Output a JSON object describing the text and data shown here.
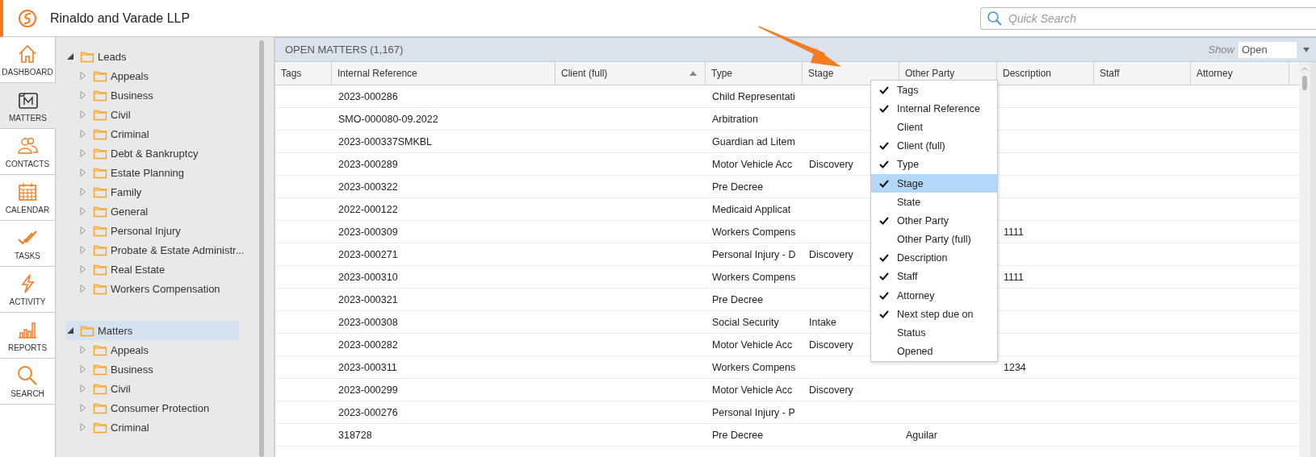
{
  "header": {
    "title": "Rinaldo and Varade LLP",
    "search": {
      "placeholder": "Quick Search"
    }
  },
  "nav": [
    {
      "label": "DASHBOARD",
      "kind": "home",
      "selected": false
    },
    {
      "label": "MATTERS",
      "kind": "matters",
      "selected": true
    },
    {
      "label": "CONTACTS",
      "kind": "contacts",
      "selected": false
    },
    {
      "label": "CALENDAR",
      "kind": "calendar",
      "selected": false
    },
    {
      "label": "TASKS",
      "kind": "tasks",
      "selected": false
    },
    {
      "label": "ACTIVITY",
      "kind": "activity",
      "selected": false
    },
    {
      "label": "REPORTS",
      "kind": "reports",
      "selected": false
    },
    {
      "label": "SEARCH",
      "kind": "search",
      "selected": false
    }
  ],
  "tree": [
    {
      "label": "Leads",
      "expanded": true,
      "selected": false,
      "children": [
        {
          "label": "Appeals",
          "expanded": false,
          "selected": false
        },
        {
          "label": "Business",
          "expanded": false,
          "selected": false
        },
        {
          "label": "Civil",
          "expanded": false,
          "selected": false
        },
        {
          "label": "Criminal",
          "expanded": false,
          "selected": false
        },
        {
          "label": "Debt & Bankruptcy",
          "expanded": false,
          "selected": false
        },
        {
          "label": "Estate Planning",
          "expanded": false,
          "selected": false
        },
        {
          "label": "Family",
          "expanded": false,
          "selected": false
        },
        {
          "label": "General",
          "expanded": false,
          "selected": false
        },
        {
          "label": "Personal Injury",
          "expanded": false,
          "selected": false
        },
        {
          "label": "Probate & Estate Administr...",
          "expanded": false,
          "selected": false
        },
        {
          "label": "Real Estate",
          "expanded": false,
          "selected": false
        },
        {
          "label": "Workers Compensation",
          "expanded": false,
          "selected": false
        }
      ]
    },
    {
      "label": "Matters",
      "expanded": true,
      "selected": true,
      "children": [
        {
          "label": "Appeals",
          "expanded": false,
          "selected": false
        },
        {
          "label": "Business",
          "expanded": false,
          "selected": false
        },
        {
          "label": "Civil",
          "expanded": false,
          "selected": false
        },
        {
          "label": "Consumer Protection",
          "expanded": false,
          "selected": false
        },
        {
          "label": "Criminal",
          "expanded": false,
          "selected": false
        }
      ]
    }
  ],
  "matters": {
    "title": "OPEN MATTERS (1,167)",
    "show_label": "Show",
    "show_value": "Open",
    "columns": [
      {
        "label": "Tags",
        "sorted": false
      },
      {
        "label": "Internal Reference",
        "sorted": false
      },
      {
        "label": "Client (full)",
        "sorted": true
      },
      {
        "label": "Type",
        "sorted": false
      },
      {
        "label": "Stage",
        "sorted": false
      },
      {
        "label": "Other Party",
        "sorted": false
      },
      {
        "label": "Description",
        "sorted": false
      },
      {
        "label": "Staff",
        "sorted": false
      },
      {
        "label": "Attorney",
        "sorted": false
      }
    ],
    "rows": [
      {
        "internal_reference": "2023-000286",
        "type": "Child Representati"
      },
      {
        "internal_reference": "SMO-000080-09.2022",
        "type": "Arbitration"
      },
      {
        "internal_reference": "2023-000337SMKBL",
        "type": "Guardian ad Litem"
      },
      {
        "internal_reference": "2023-000289",
        "type": "Motor Vehicle Acc",
        "stage": "Discovery"
      },
      {
        "internal_reference": "2023-000322",
        "type": "Pre Decree"
      },
      {
        "internal_reference": "2022-000122",
        "type": "Medicaid Applicat"
      },
      {
        "internal_reference": "2023-000309",
        "type": "Workers Compens",
        "description": "1111"
      },
      {
        "internal_reference": "2023-000271",
        "type": "Personal Injury - D",
        "stage": "Discovery"
      },
      {
        "internal_reference": "2023-000310",
        "type": "Workers Compens",
        "description": "1111"
      },
      {
        "internal_reference": "2023-000321",
        "type": "Pre Decree"
      },
      {
        "internal_reference": "2023-000308",
        "type": "Social Security",
        "stage": "Intake"
      },
      {
        "internal_reference": "2023-000282",
        "type": "Motor Vehicle Acc",
        "stage": "Discovery"
      },
      {
        "internal_reference": "2023-000311",
        "type": "Workers Compens",
        "description": "1234"
      },
      {
        "internal_reference": "2023-000299",
        "type": "Motor Vehicle Acc",
        "stage": "Discovery"
      },
      {
        "internal_reference": "2023-000276",
        "type": "Personal Injury - P"
      },
      {
        "internal_reference": "318728",
        "type": "Pre Decree",
        "other_party": "Aguilar"
      }
    ]
  },
  "column_menu": {
    "items": [
      {
        "label": "Tags",
        "checked": true,
        "selected": false
      },
      {
        "label": "Internal Reference",
        "checked": true,
        "selected": false
      },
      {
        "label": "Client",
        "checked": false,
        "selected": false
      },
      {
        "label": "Client (full)",
        "checked": true,
        "selected": false
      },
      {
        "label": "Type",
        "checked": true,
        "selected": false
      },
      {
        "label": "Stage",
        "checked": true,
        "selected": true
      },
      {
        "label": "State",
        "checked": false,
        "selected": false
      },
      {
        "label": "Other Party",
        "checked": true,
        "selected": false
      },
      {
        "label": "Other Party (full)",
        "checked": false,
        "selected": false
      },
      {
        "label": "Description",
        "checked": true,
        "selected": false
      },
      {
        "label": "Staff",
        "checked": true,
        "selected": false
      },
      {
        "label": "Attorney",
        "checked": true,
        "selected": false
      },
      {
        "label": "Next step due on",
        "checked": true,
        "selected": false
      },
      {
        "label": "Status",
        "checked": false,
        "selected": false
      },
      {
        "label": "Opened",
        "checked": false,
        "selected": false
      }
    ]
  }
}
